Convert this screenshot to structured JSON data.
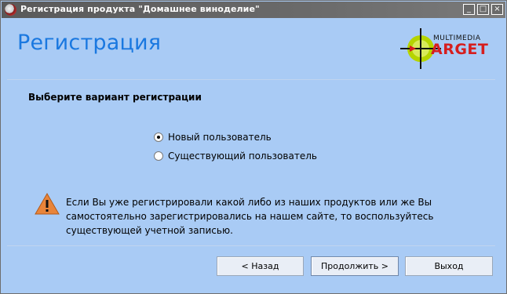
{
  "window": {
    "title": "Регистрация продукта \"Домашнее виноделие\"",
    "controls": {
      "minimize": "_",
      "maximize": "□",
      "close": "×"
    }
  },
  "header": {
    "title": "Регистрация",
    "logo": {
      "top_text": "MULTIMEDIA",
      "main_text": "ARGET"
    }
  },
  "instruction": "Выберите вариант регистрации",
  "options": [
    {
      "label": "Новый пользователь",
      "checked": true
    },
    {
      "label": "Существующий пользователь",
      "checked": false
    }
  ],
  "notice": {
    "icon": "warning-icon",
    "lines": [
      "Если Вы уже регистрировали какой либо из наших продуктов или же Вы",
      "самостоятельно зарегистрировались на нашем сайте, то воспользуйтесь",
      "существующей учетной записью."
    ]
  },
  "buttons": {
    "back": "< Назад",
    "next": "Продолжить >",
    "exit": "Выход"
  },
  "colors": {
    "background": "#a9cbf5",
    "title_accent": "#1a78e0",
    "titlebar": "#6a6a6a",
    "logo_red": "#d61e1e",
    "logo_green": "#b5d400"
  }
}
